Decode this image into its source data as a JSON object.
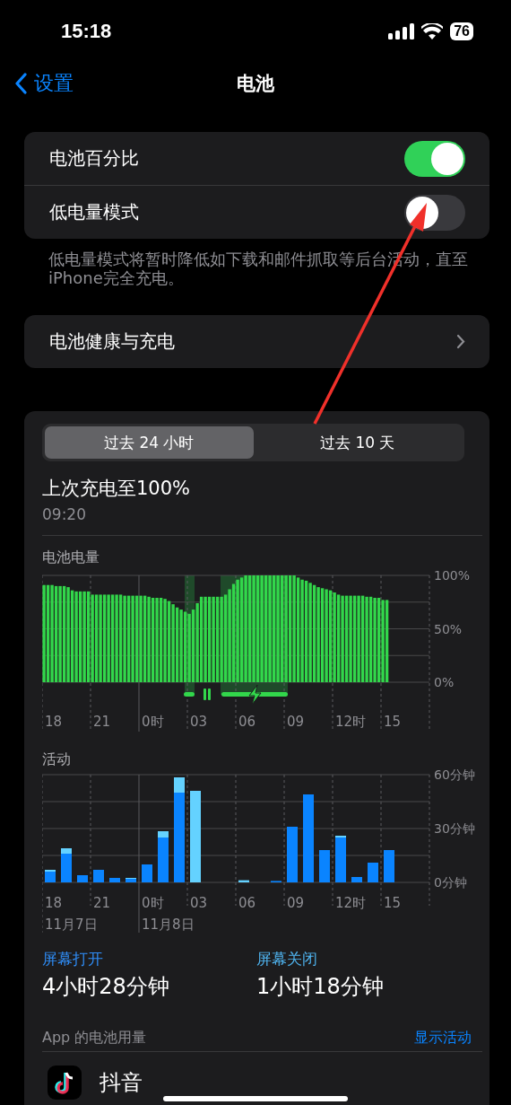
{
  "status_bar": {
    "time": "15:18",
    "battery": "76"
  },
  "nav": {
    "back": "设置",
    "title": "电池"
  },
  "settings": [
    {
      "label": "电池百分比",
      "on": true
    },
    {
      "label": "低电量模式",
      "on": false
    }
  ],
  "settings_footer": "低电量模式将暂时降低如下载和邮件抓取等后台活动，直至iPhone完全充电。",
  "health_row": {
    "label": "电池健康与充电"
  },
  "range_tabs": [
    {
      "label": "过去 24 小时",
      "selected": true
    },
    {
      "label": "过去 10 天",
      "selected": false
    }
  ],
  "last_charge": {
    "title": "上次充电至100%",
    "time": "09:20"
  },
  "battery_chart": {
    "x_labels": [
      {
        "label": "18"
      },
      {
        "label": "21"
      },
      {
        "label": "0时"
      },
      {
        "label": "03"
      },
      {
        "label": "06"
      },
      {
        "label": "09"
      },
      {
        "label": "12时"
      },
      {
        "label": "15"
      }
    ],
    "chart_data": {
      "type": "bar",
      "ylim": [
        0,
        100
      ],
      "yticks": [
        {
          "value": 0,
          "label": "0%"
        },
        {
          "value": 50,
          "label": "50%"
        },
        {
          "value": 100,
          "label": "100%"
        }
      ],
      "series": [
        {
          "name": "电池电量",
          "color": "#32d74b",
          "values": [
            91,
            91,
            91,
            90,
            90,
            90,
            89,
            86,
            85,
            85,
            85,
            85,
            82,
            82,
            82,
            82,
            82,
            82,
            82,
            82,
            81,
            81,
            81,
            81,
            81,
            81,
            80,
            79,
            79,
            79,
            78,
            76,
            73,
            70,
            68,
            66,
            64,
            68,
            74,
            80,
            80,
            80,
            80,
            80,
            80,
            82,
            87,
            92,
            96,
            98,
            100,
            100,
            100,
            100,
            100,
            100,
            100,
            100,
            100,
            100,
            100,
            100,
            100,
            98,
            96,
            95,
            93,
            91,
            89,
            88,
            87,
            86,
            84,
            82,
            81,
            81,
            81,
            81,
            81,
            81,
            80,
            80,
            79,
            79,
            77,
            77,
            null,
            null,
            null,
            null,
            null,
            null,
            null,
            null,
            null,
            null
          ]
        }
      ]
    }
  },
  "activity_chart": {
    "title": "活动",
    "x_labels": [
      {
        "label": "18",
        "date": "11月7日"
      },
      {
        "label": "21"
      },
      {
        "label": "0时",
        "date": "11月8日"
      },
      {
        "label": "03"
      },
      {
        "label": "06"
      },
      {
        "label": "09"
      },
      {
        "label": "12时"
      },
      {
        "label": "15"
      }
    ],
    "chart_data": {
      "type": "bar",
      "stacked": true,
      "ylim": [
        0,
        60
      ],
      "yticks": [
        {
          "value": 0,
          "label": "0分钟"
        },
        {
          "value": 30,
          "label": "30分钟"
        },
        {
          "value": 60,
          "label": "60分钟"
        }
      ],
      "series": [
        {
          "name": "屏幕打开",
          "color": "#0a84ff",
          "values": [
            6,
            16,
            4,
            7,
            2.5,
            2,
            10,
            25,
            50,
            0,
            0,
            0,
            0,
            0,
            0.8,
            31,
            49,
            18,
            25,
            3,
            11,
            18,
            null,
            null
          ]
        },
        {
          "name": "屏幕关闭",
          "color": "#64d2ff",
          "values": [
            1,
            3,
            0,
            0,
            0,
            0.5,
            0,
            3.5,
            8.5,
            51,
            0,
            0,
            1.2,
            0,
            0,
            0,
            0,
            0,
            1,
            0,
            0,
            0,
            null,
            null
          ]
        }
      ]
    }
  },
  "screen_time": [
    {
      "value": "4小时28分钟"
    },
    {
      "value": "1小时18分钟"
    }
  ],
  "app_usage": {
    "title": "App 的电池用量",
    "action": "显示活动",
    "apps": [
      {
        "name": "抖音"
      }
    ]
  }
}
